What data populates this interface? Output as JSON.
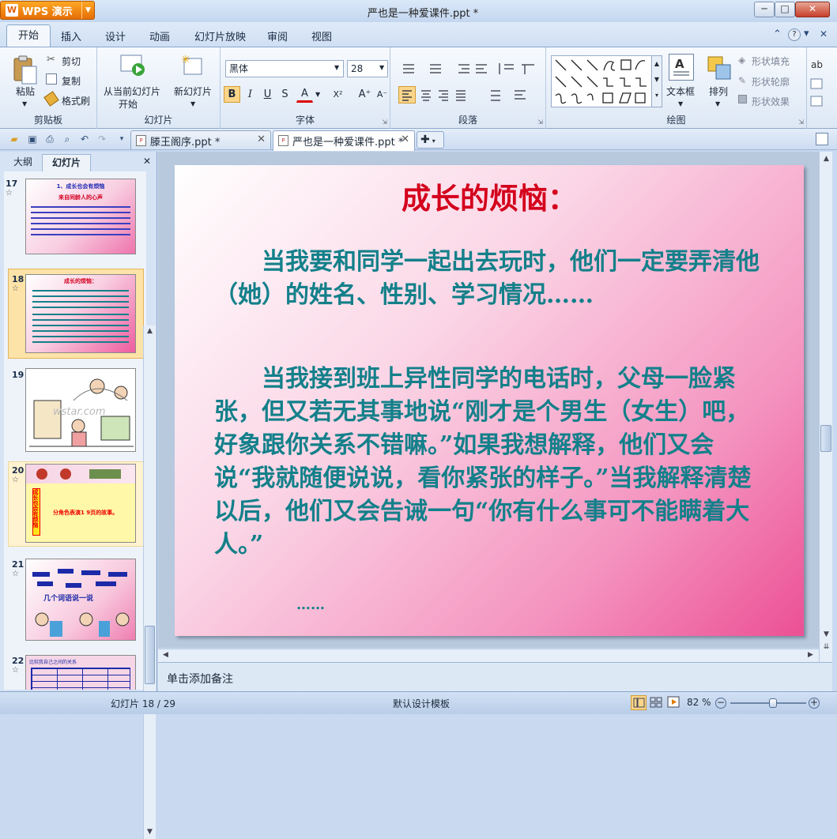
{
  "app": {
    "logo_label": "WPS 演示",
    "window_title": "严也是一种爱课件.ppt *"
  },
  "window_controls": {
    "minimize": "─",
    "maximize": "□",
    "close": "✕"
  },
  "menu": {
    "items": [
      "开始",
      "插入",
      "设计",
      "动画",
      "幻灯片放映",
      "审阅",
      "视图"
    ]
  },
  "ribbon": {
    "clipboard": {
      "paste": "粘贴",
      "cut": "剪切",
      "copy": "复制",
      "format_painter": "格式刷",
      "group": "剪贴板"
    },
    "slides": {
      "from_current": "从当前幻灯片",
      "start": "开始",
      "new_slide": "新幻灯片",
      "group": "幻灯片"
    },
    "font": {
      "name": "黑体",
      "size": "28",
      "bold": "B",
      "italic": "I",
      "underline": "U",
      "shadow": "S",
      "color": "A",
      "superscript": "X²",
      "grow": "A⁺",
      "shrink": "A⁻",
      "group": "字体"
    },
    "paragraph": {
      "group": "段落"
    },
    "drawing": {
      "textbox": "文本框",
      "arrange": "排列",
      "fill": "形状填充",
      "outline": "形状轮廓",
      "effect": "形状效果",
      "group": "绘图"
    }
  },
  "tabs": [
    {
      "label": "滕王阁序.ppt *",
      "active": false
    },
    {
      "label": "严也是一种爱课件.ppt *",
      "active": true
    }
  ],
  "panel": {
    "tab_outline": "大纲",
    "tab_slides": "幻灯片",
    "close": "✕"
  },
  "thumbnails": [
    {
      "number": "17",
      "title": "1、成长也会有烦恼",
      "subtitle": "来自同龄人的心声"
    },
    {
      "number": "18",
      "title": "成长的烦恼：",
      "selected": true
    },
    {
      "number": "19",
      "watermark": "wstar.com"
    },
    {
      "number": "20",
      "caption": "分角色表演1 9页的故事。",
      "side": "成长也会有烦恼"
    },
    {
      "number": "21",
      "caption": "几个词语说一说"
    },
    {
      "number": "22",
      "caption": "比较我自己之间的关系"
    }
  ],
  "slide": {
    "title": "成长的烦恼：",
    "para1": "当我要和同学一起出去玩时，他们一定要弄清他（她）的姓名、性别、学习情况……",
    "para2": "当我接到班上异性同学的电话时，父母一脸紧张，但又若无其事地说“刚才是个男生（女生）吧，好象跟你关系不错嘛。”如果我想解释，他们又会说“我就随便说说，看你紧张的样子。”当我解释清楚以后，他们又会告诫一句“你有什么事可不能瞒着大人。”",
    "ellipsis": "……"
  },
  "notes": {
    "placeholder": "单击添加备注"
  },
  "status": {
    "slide_info": "幻灯片 18 / 29",
    "template": "默认设计模板",
    "zoom": "82 %",
    "zoom_level": 82
  },
  "colors": {
    "accent_orange": "#f08a10",
    "slide_title": "#d4001c",
    "slide_text": "#13808a",
    "selected_thumb": "#fde3a7"
  }
}
